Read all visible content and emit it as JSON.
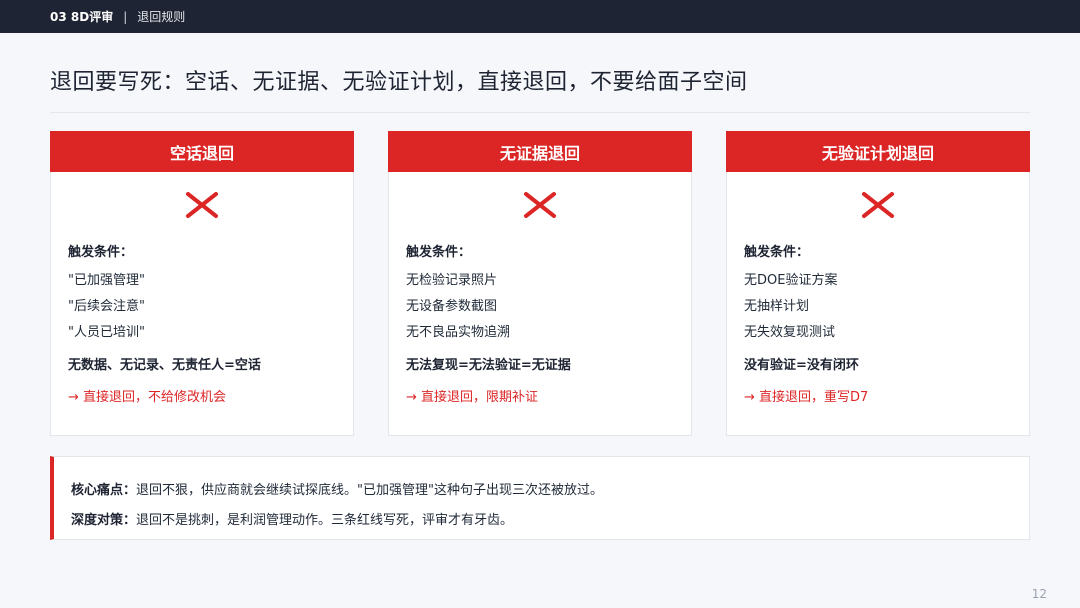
{
  "topbar": {
    "section": "03 8D评审",
    "separator": "|",
    "breadcrumb": "退回规则"
  },
  "headline": "退回要写死：空话、无证据、无验证计划，直接退回，不要给面子空间",
  "cards": [
    {
      "title": "空话退回",
      "trigger_label": "触发条件：",
      "items": [
        "\"已加强管理\"",
        "\"后续会注意\"",
        "\"人员已培训\""
      ],
      "summary": "无数据、无记录、无责任人=空话",
      "action": "→ 直接退回，不给修改机会"
    },
    {
      "title": "无证据退回",
      "trigger_label": "触发条件：",
      "items": [
        "无检验记录照片",
        "无设备参数截图",
        "无不良品实物追溯"
      ],
      "summary": "无法复现=无法验证=无证据",
      "action": "→ 直接退回，限期补证"
    },
    {
      "title": "无验证计划退回",
      "trigger_label": "触发条件：",
      "items": [
        "无DOE验证方案",
        "无抽样计划",
        "无失效复现测试"
      ],
      "summary": "没有验证=没有闭环",
      "action": "→ 直接退回，重写D7"
    }
  ],
  "notice": {
    "pain_label": "核心痛点：",
    "pain_text": "退回不狠，供应商就会继续试探底线。\"已加强管理\"这种句子出现三次还被放过。",
    "strategy_label": "深度对策：",
    "strategy_text": "退回不是挑刺，是利润管理动作。三条红线写死，评审才有牙齿。"
  },
  "page_number": "12",
  "colors": {
    "accent": "#dc2626",
    "topbar": "#1e2433"
  },
  "icons": {
    "reject": "x-mark-icon"
  }
}
